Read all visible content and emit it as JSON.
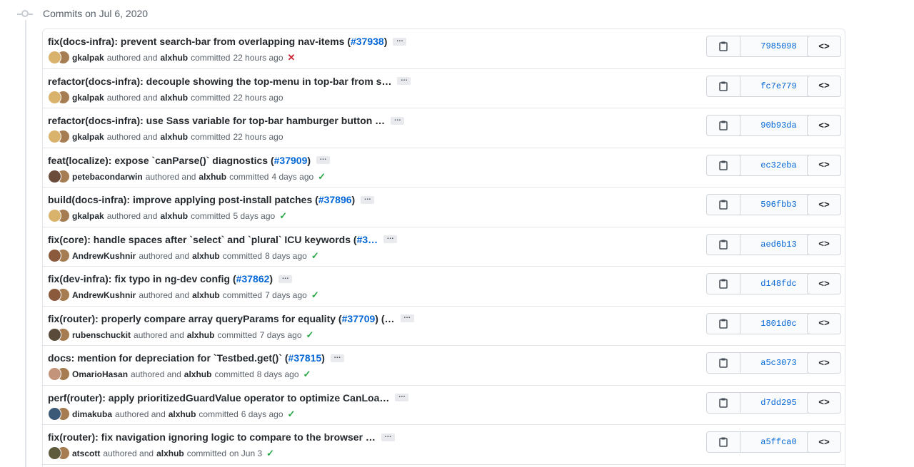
{
  "group_header": "Commits on Jul 6, 2020",
  "labels": {
    "authored": "authored and",
    "committed": "committed"
  },
  "commits": [
    {
      "title": "fix(docs-infra): prevent search-bar from overlapping nav-items (",
      "pr": "#37938",
      "title_end": ")",
      "author": "gkalpak",
      "committer": "alxhub",
      "time": "22 hours ago",
      "status": "failure",
      "sha": "7985098",
      "avatar_color": "#d9b36c"
    },
    {
      "title": "refactor(docs-infra): decouple showing the top-menu in top-bar from s…",
      "pr": "",
      "title_end": "",
      "author": "gkalpak",
      "committer": "alxhub",
      "time": "22 hours ago",
      "status": "none",
      "sha": "fc7e779",
      "avatar_color": "#d9b36c"
    },
    {
      "title": "refactor(docs-infra): use Sass variable for top-bar hamburger button …",
      "pr": "",
      "title_end": "",
      "author": "gkalpak",
      "committer": "alxhub",
      "time": "22 hours ago",
      "status": "none",
      "sha": "90b93da",
      "avatar_color": "#d9b36c"
    },
    {
      "title": "feat(localize): expose `canParse()` diagnostics (",
      "pr": "#37909",
      "title_end": ")",
      "author": "petebacondarwin",
      "committer": "alxhub",
      "time": "4 days ago",
      "status": "success",
      "sha": "ec32eba",
      "avatar_color": "#6b4c3b"
    },
    {
      "title": "build(docs-infra): improve applying post-install patches (",
      "pr": "#37896",
      "title_end": ")",
      "author": "gkalpak",
      "committer": "alxhub",
      "time": "5 days ago",
      "status": "success",
      "sha": "596fbb3",
      "avatar_color": "#d9b36c"
    },
    {
      "title": "fix(core): handle spaces after `select` and `plural` ICU keywords (",
      "pr": "#3…",
      "title_end": "",
      "author": "AndrewKushnir",
      "committer": "alxhub",
      "time": "8 days ago",
      "status": "success",
      "sha": "aed6b13",
      "avatar_color": "#8b5a3c"
    },
    {
      "title": "fix(dev-infra): fix typo in ng-dev config (",
      "pr": "#37862",
      "title_end": ")",
      "author": "AndrewKushnir",
      "committer": "alxhub",
      "time": "7 days ago",
      "status": "success",
      "sha": "d148fdc",
      "avatar_color": "#8b5a3c"
    },
    {
      "title": "fix(router): properly compare array queryParams for equality (",
      "pr": "#37709",
      "title_end": ") (…",
      "author": "rubenschuckit",
      "committer": "alxhub",
      "time": "7 days ago",
      "status": "success",
      "sha": "1801d0c",
      "avatar_color": "#5a4a3a"
    },
    {
      "title": "docs: mention for depreciation for `Testbed.get()` (",
      "pr": "#37815",
      "title_end": ")",
      "author": "OmarioHasan",
      "committer": "alxhub",
      "time": "8 days ago",
      "status": "success",
      "sha": "a5c3073",
      "avatar_color": "#c4947a"
    },
    {
      "title": "perf(router): apply prioritizedGuardValue operator to optimize CanLoa…",
      "pr": "",
      "title_end": "",
      "author": "dimakuba",
      "committer": "alxhub",
      "time": "6 days ago",
      "status": "success",
      "sha": "d7dd295",
      "avatar_color": "#3b5a78"
    },
    {
      "title": "fix(router): fix navigation ignoring logic to compare to the browser …",
      "pr": "",
      "title_end": "",
      "author": "atscott",
      "committer": "alxhub",
      "time": "on Jun 3",
      "status": "success",
      "sha": "a5ffca0",
      "avatar_color": "#5e5a3c"
    }
  ],
  "icons": {
    "status_failure": "✕",
    "status_success": "✓",
    "copy": "clipboard-icon",
    "browse": "<>",
    "ellipsis": "…",
    "copy_glyph": "📋"
  }
}
